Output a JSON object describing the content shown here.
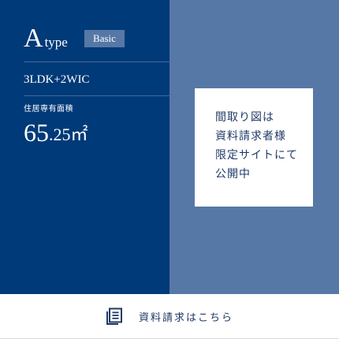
{
  "plan": {
    "type_letter": "A",
    "type_word": "type",
    "badge": "Basic",
    "layout": "3LDK+2WIC",
    "area_label": "住居専有面積",
    "area_integer": "65",
    "area_decimal": ".25",
    "area_unit": "㎡"
  },
  "notice": {
    "lines": [
      "間取り図は",
      "資料請求者様",
      "限定サイトにて",
      "公開中"
    ]
  },
  "footer": {
    "icon": "document-list-icon",
    "label": "資料請求はこちら"
  },
  "colors": {
    "left_panel": "#003a78",
    "right_panel": "#5678a6",
    "accent_text": "#1f3a66"
  }
}
